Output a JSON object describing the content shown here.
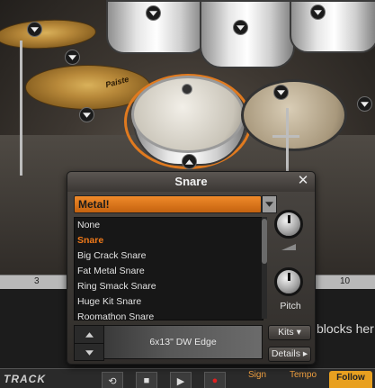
{
  "panel": {
    "title": "Snare",
    "close_label": "✕",
    "selected_preset": "Metal!",
    "list_items": [
      "None",
      "Snare",
      "Big Crack Snare",
      "Fat Metal Snare",
      "Ring Smack Snare",
      "Huge Kit Snare",
      "Roomathon Snare"
    ],
    "active_item_index": 1,
    "articulation_label": "6x13\" DW Edge",
    "pitch_label": "Pitch",
    "kits_label": "Kits",
    "details_label": "Details"
  },
  "timeline": {
    "ruler_numbers": [
      "3",
      "10"
    ],
    "hint_text": "blocks her"
  },
  "transport": {
    "logo": "TRACK",
    "sign_label": "Sign",
    "tempo_label": "Tempo",
    "follow_label": "Follow"
  },
  "cymbal_logo": "Paiste",
  "colors": {
    "accent": "#e07a1f",
    "preset_bg": "#c4620f",
    "list_bg": "#171717",
    "active_item": "#f07a1a"
  }
}
